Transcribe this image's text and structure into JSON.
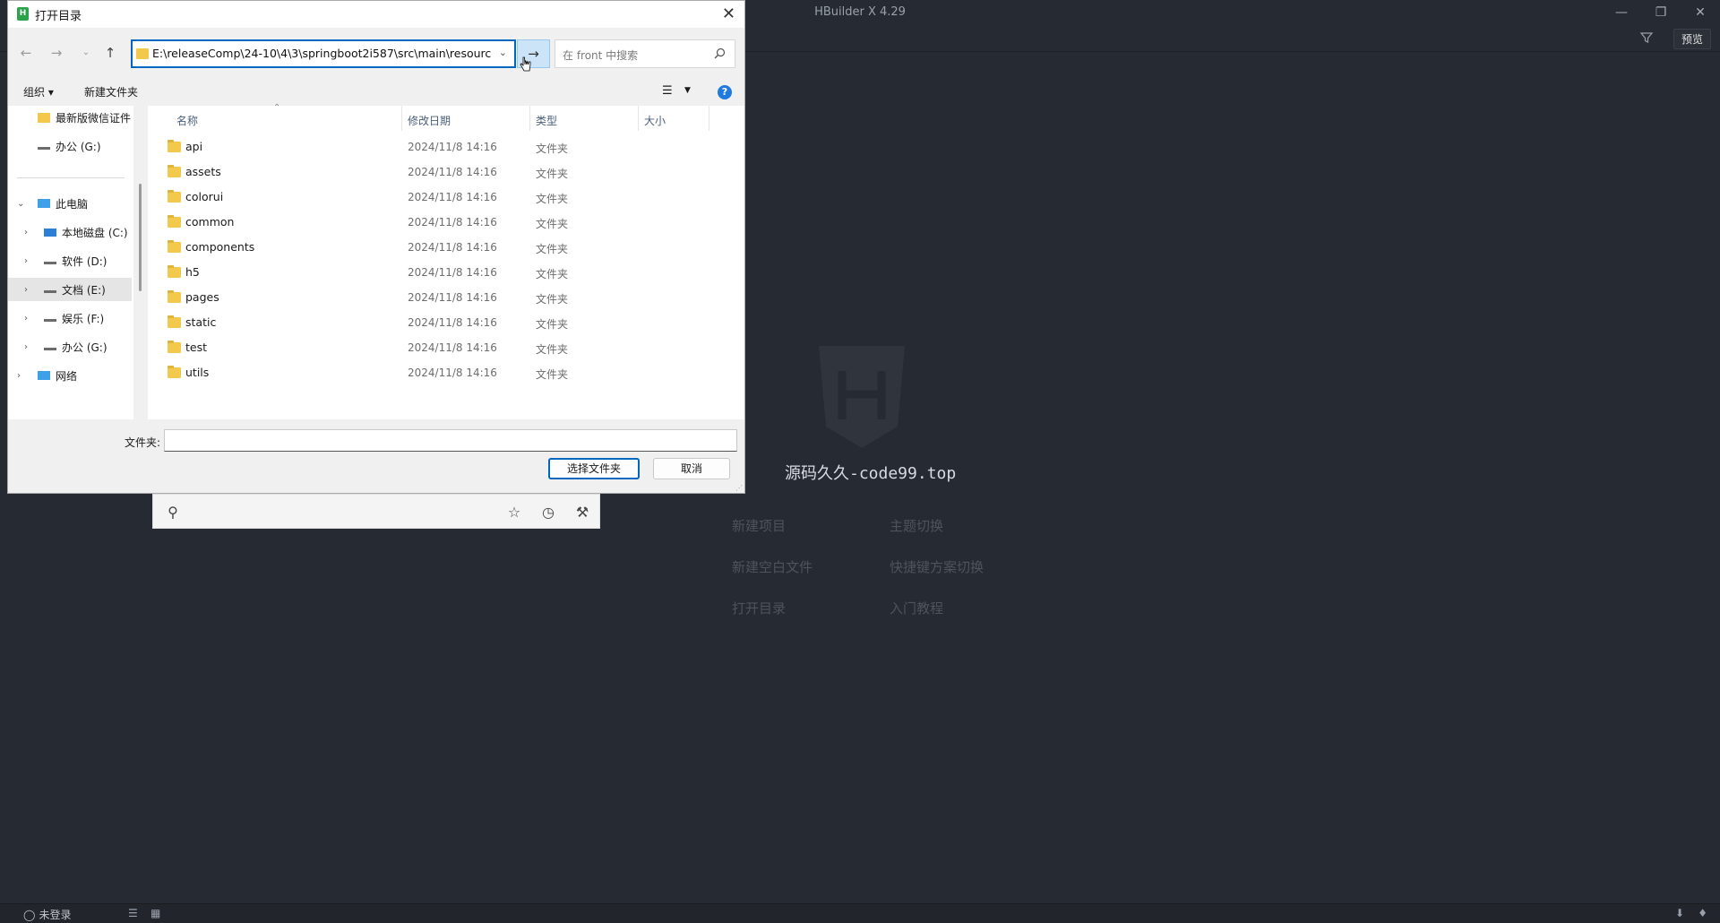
{
  "app": {
    "title": "HBuilder X 4.29",
    "preview_label": "预览",
    "brand": "源码久久-code99.top",
    "actions": [
      "新建项目",
      "主题切换",
      "新建空白文件",
      "快捷键方案切换",
      "打开目录",
      "入门教程"
    ],
    "status_user": "未登录"
  },
  "dialog": {
    "title": "打开目录",
    "address": "E:\\releaseComp\\24-10\\4\\3\\springboot2i587\\src\\main\\resourc",
    "search_placeholder": "在 front 中搜索",
    "organize_label": "组织 ▾",
    "new_folder_label": "新建文件夹",
    "nav_items": [
      {
        "label": "最新版微信证件"
      },
      {
        "label": "办公 (G:)"
      },
      {
        "label": "此电脑"
      },
      {
        "label": "本地磁盘 (C:)"
      },
      {
        "label": "软件 (D:)"
      },
      {
        "label": "文档 (E:)"
      },
      {
        "label": "娱乐 (F:)"
      },
      {
        "label": "办公 (G:)"
      },
      {
        "label": "网络"
      }
    ],
    "columns": {
      "name": "名称",
      "date": "修改日期",
      "type": "类型",
      "size": "大小"
    },
    "files": [
      {
        "name": "api",
        "date": "2024/11/8 14:16",
        "type": "文件夹"
      },
      {
        "name": "assets",
        "date": "2024/11/8 14:16",
        "type": "文件夹"
      },
      {
        "name": "colorui",
        "date": "2024/11/8 14:16",
        "type": "文件夹"
      },
      {
        "name": "common",
        "date": "2024/11/8 14:16",
        "type": "文件夹"
      },
      {
        "name": "components",
        "date": "2024/11/8 14:16",
        "type": "文件夹"
      },
      {
        "name": "h5",
        "date": "2024/11/8 14:16",
        "type": "文件夹"
      },
      {
        "name": "pages",
        "date": "2024/11/8 14:16",
        "type": "文件夹"
      },
      {
        "name": "static",
        "date": "2024/11/8 14:16",
        "type": "文件夹"
      },
      {
        "name": "test",
        "date": "2024/11/8 14:16",
        "type": "文件夹"
      },
      {
        "name": "utils",
        "date": "2024/11/8 14:16",
        "type": "文件夹"
      }
    ],
    "folder_label": "文件夹:",
    "folder_value": "",
    "select_button": "选择文件夹",
    "cancel_button": "取消"
  }
}
